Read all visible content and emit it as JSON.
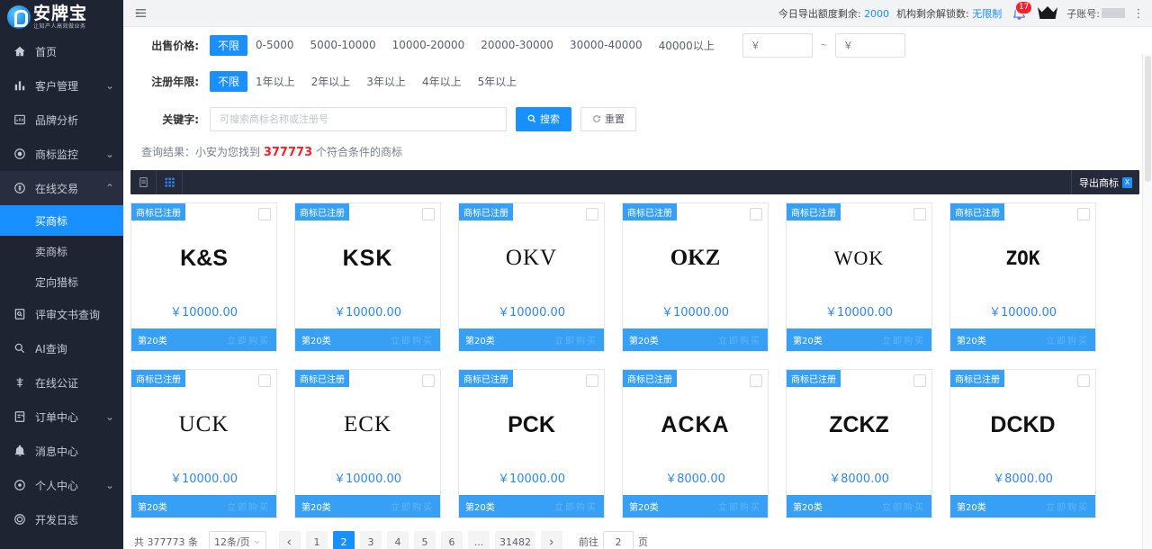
{
  "sidebar": {
    "logo": {
      "title": "安牌宝",
      "tagline": "让知产人高效做业务"
    },
    "items": [
      {
        "label": "首页",
        "icon": "home-icon",
        "arrow": ""
      },
      {
        "label": "客户管理",
        "icon": "chart-bar-icon",
        "arrow": "⌄"
      },
      {
        "label": "品牌分析",
        "icon": "analysis-icon",
        "arrow": ""
      },
      {
        "label": "商标监控",
        "icon": "monitor-icon",
        "arrow": "⌄"
      },
      {
        "label": "在线交易",
        "icon": "transaction-icon",
        "arrow": "⌃"
      },
      {
        "label": "评审文书查询",
        "icon": "document-search-icon",
        "arrow": ""
      },
      {
        "label": "AI查询",
        "icon": "ai-search-icon",
        "arrow": ""
      },
      {
        "label": "在线公证",
        "icon": "notarization-icon",
        "arrow": ""
      },
      {
        "label": "订单中心",
        "icon": "order-icon",
        "arrow": "⌄"
      },
      {
        "label": "消息中心",
        "icon": "bell-icon",
        "arrow": ""
      },
      {
        "label": "个人中心",
        "icon": "user-center-icon",
        "arrow": "⌄"
      },
      {
        "label": "开发日志",
        "icon": "dev-log-icon",
        "arrow": ""
      }
    ],
    "submenu": [
      {
        "label": "买商标",
        "active": true
      },
      {
        "label": "卖商标",
        "active": false
      },
      {
        "label": "定向猎标",
        "active": false
      }
    ]
  },
  "topbar": {
    "collapse_icon": "menu-collapse-icon",
    "export_quota_label": "今日导出额度剩余:",
    "export_quota_value": "2000",
    "unlock_label": "机构剩余解锁数:",
    "unlock_value": "无限制",
    "bell_icon": "bell-icon",
    "bell_badge": "17",
    "crown_icon": "crown-icon",
    "subaccount_label": "子账号:",
    "more_icon": "more-vertical-icon"
  },
  "filters": {
    "price": {
      "label": "出售价格:",
      "options": [
        "不限",
        "0-5000",
        "5000-10000",
        "10000-20000",
        "20000-30000",
        "30000-40000",
        "40000以上"
      ],
      "active": "不限",
      "min_placeholder": "￥",
      "max_placeholder": "￥",
      "separator": "~"
    },
    "years": {
      "label": "注册年限:",
      "options": [
        "不限",
        "1年以上",
        "2年以上",
        "3年以上",
        "4年以上",
        "5年以上"
      ],
      "active": "不限"
    },
    "keyword": {
      "label": "关键字:",
      "placeholder": "可搜索商标名称或注册号",
      "value": "",
      "search_button": "搜索",
      "search_icon": "search-icon",
      "reset_button": "重置",
      "reset_icon": "refresh-icon"
    }
  },
  "result": {
    "prefix": "查询结果：小安为您找到",
    "count": "377773",
    "suffix": "个符合条件的商标"
  },
  "toolbar": {
    "list_view_icon": "list-view-icon",
    "grid_view_icon": "grid-view-icon",
    "export_label": "导出商标",
    "export_icon": "excel-icon"
  },
  "cards": [
    {
      "badge": "商标已注册",
      "mark": "K&S",
      "font": "f-sans-bold",
      "price": "￥10000.00",
      "category": "第20类"
    },
    {
      "badge": "商标已注册",
      "mark": "KSK",
      "font": "f-sans-wide",
      "price": "￥10000.00",
      "category": "第20类"
    },
    {
      "badge": "商标已注册",
      "mark": "OKV",
      "font": "f-serif",
      "price": "￥10000.00",
      "category": "第20类"
    },
    {
      "badge": "商标已注册",
      "mark": "OKZ",
      "font": "f-serif-bold",
      "price": "￥10000.00",
      "category": "第20类"
    },
    {
      "badge": "商标已注册",
      "mark": "WOK",
      "font": "f-serif-small",
      "price": "￥10000.00",
      "category": "第20类"
    },
    {
      "badge": "商标已注册",
      "mark": "ZOK",
      "font": "f-mono",
      "price": "￥10000.00",
      "category": "第20类"
    },
    {
      "badge": "商标已注册",
      "mark": "UCK",
      "font": "f-serif",
      "price": "￥10000.00",
      "category": "第20类"
    },
    {
      "badge": "商标已注册",
      "mark": "ECK",
      "font": "f-serif",
      "price": "￥10000.00",
      "category": "第20类"
    },
    {
      "badge": "商标已注册",
      "mark": "PCK",
      "font": "f-sans-bold",
      "price": "￥10000.00",
      "category": "第20类"
    },
    {
      "badge": "商标已注册",
      "mark": "ACKA",
      "font": "f-sans-wide",
      "price": "￥8000.00",
      "category": "第20类"
    },
    {
      "badge": "商标已注册",
      "mark": "ZCKZ",
      "font": "f-sans-bold",
      "price": "￥8000.00",
      "category": "第20类"
    },
    {
      "badge": "商标已注册",
      "mark": "DCKD",
      "font": "f-sans-bold",
      "price": "￥8000.00",
      "category": "第20类"
    }
  ],
  "pagination": {
    "total_text": "共 377773 条",
    "page_size": "12条/页",
    "prev_icon": "chevron-left-icon",
    "next_icon": "chevron-right-icon",
    "pages": [
      "1",
      "2",
      "3",
      "4",
      "5",
      "6",
      "...",
      "31482"
    ],
    "current": "2",
    "jump_prefix": "前往",
    "jump_value": "2",
    "jump_suffix": "页"
  },
  "colors": {
    "accent": "#1890ff",
    "card_blue": "#37a0f4",
    "sidebar_bg": "#1f2433",
    "toolbar_bg": "#242a3a",
    "danger": "#f5222d"
  }
}
